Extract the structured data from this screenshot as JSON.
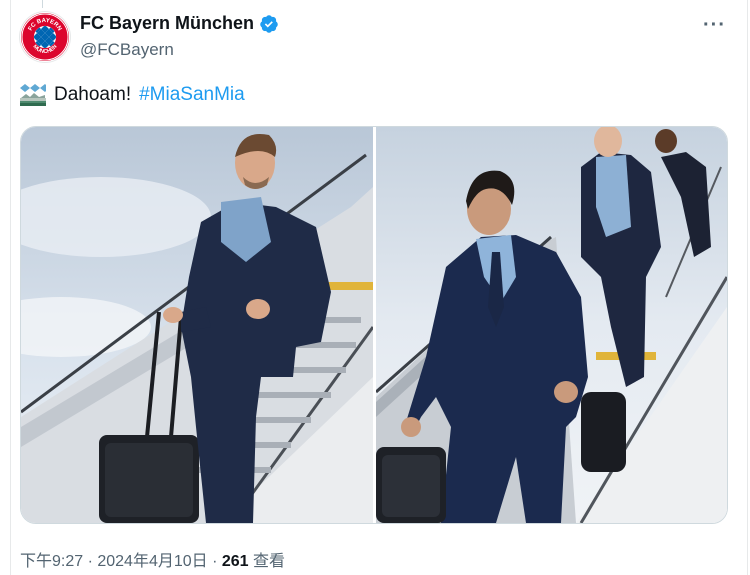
{
  "author": {
    "display_name": "FC Bayern München",
    "handle": "@FCBayern",
    "avatar_text": "FC BAYERN MÜNCHEN"
  },
  "tweet": {
    "text_before": "Dahoam!",
    "hashtag": "#MiaSanMia"
  },
  "meta": {
    "time_date": "下午9:27 · 2024年4月10日 · ",
    "views_count": "261",
    "views_label": " 查看"
  },
  "colors": {
    "brand_red": "#dc052d",
    "bavarian_blue": "#0066b2",
    "link_blue": "#1d9bf0",
    "verified_blue": "#1d9bf0"
  },
  "icons": [
    "verified-badge-icon",
    "more-options-icon",
    "bavarian-flag-emoji"
  ]
}
